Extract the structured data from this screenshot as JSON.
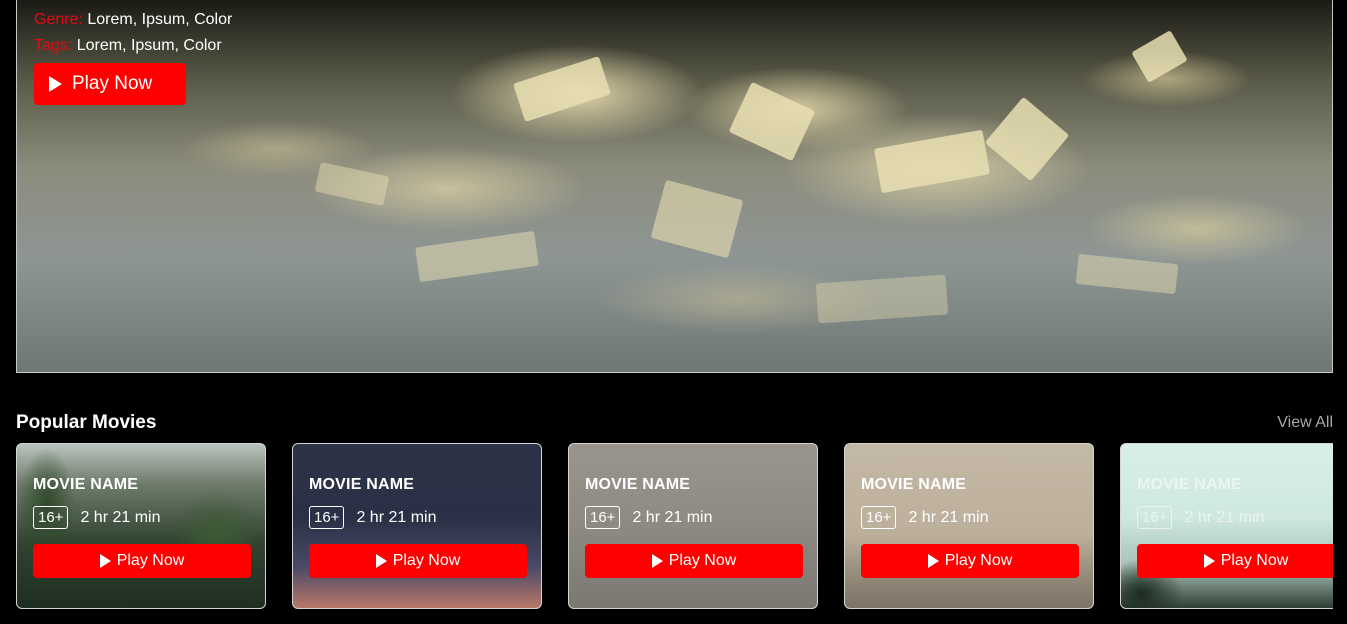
{
  "hero": {
    "genre_label": "Genre:",
    "genre_value": "Lorem, Ipsum, Color",
    "tags_label": "Tags:",
    "tags_value": "Lorem, Ipsum, Color",
    "play_label": "Play Now"
  },
  "popular": {
    "title": "Popular Movies",
    "view_all": "View All",
    "cards": [
      {
        "name": "MOVIE NAME",
        "age": "16+",
        "duration": "2 hr 21 min",
        "play": "Play Now"
      },
      {
        "name": "MOVIE NAME",
        "age": "16+",
        "duration": "2 hr 21 min",
        "play": "Play Now"
      },
      {
        "name": "MOVIE NAME",
        "age": "16+",
        "duration": "2 hr 21 min",
        "play": "Play Now"
      },
      {
        "name": "MOVIE NAME",
        "age": "16+",
        "duration": "2 hr 21 min",
        "play": "Play Now"
      },
      {
        "name": "MOVIE NAME",
        "age": "16+",
        "duration": "2 hr 21 min",
        "play": "Play Now"
      }
    ]
  },
  "colors": {
    "accent": "#ff0000",
    "label_red": "#e50914",
    "background": "#000000",
    "muted_link": "#a8a8a8"
  },
  "icons": {
    "play": "play-icon"
  }
}
